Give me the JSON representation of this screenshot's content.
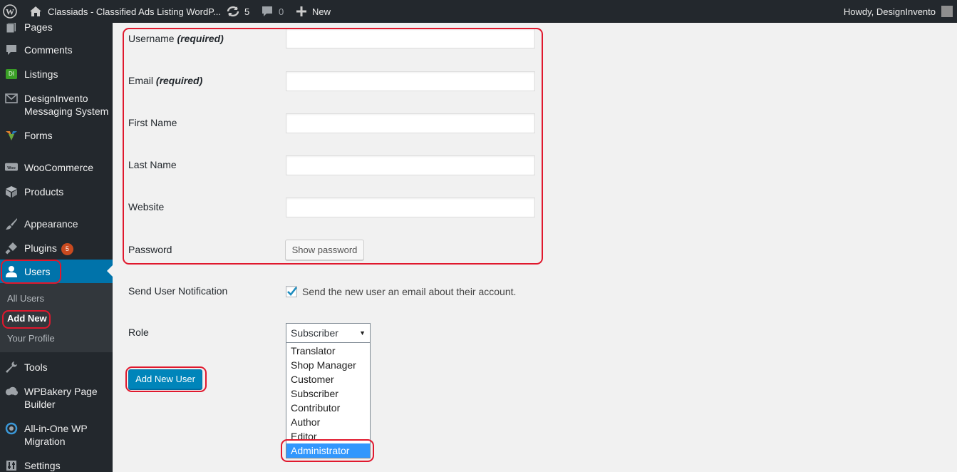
{
  "admin_bar": {
    "site_title": "Classiads - Classified Ads Listing WordP...",
    "updates_count": "5",
    "comments_count": "0",
    "new_label": "New",
    "howdy": "Howdy, DesignInvento"
  },
  "sidebar": {
    "items": [
      {
        "label": "Pages",
        "icon": "pages-icon"
      },
      {
        "label": "Comments",
        "icon": "comment-icon"
      },
      {
        "label": "Listings",
        "icon": "di-icon",
        "icon_text": "DI"
      },
      {
        "label": "DesignInvento Messaging System",
        "label_line1": "DesignInvento",
        "label_line2": "Messaging System",
        "icon": "mail-icon"
      },
      {
        "label": "Forms",
        "icon": "forms-icon"
      },
      {
        "label": "WooCommerce",
        "icon": "woocommerce-icon",
        "icon_text": "Woo"
      },
      {
        "label": "Products",
        "icon": "box-icon"
      },
      {
        "label": "Appearance",
        "icon": "paintbrush-icon"
      },
      {
        "label": "Plugins",
        "icon": "plugin-icon",
        "badge": "5"
      },
      {
        "label": "Users",
        "icon": "user-icon",
        "current": true
      },
      {
        "label": "Tools",
        "icon": "wrench-icon"
      },
      {
        "label": "WPBakery Page Builder",
        "label_line1": "WPBakery Page",
        "label_line2": "Builder",
        "icon": "cloud-icon"
      },
      {
        "label": "All-in-One WP Migration",
        "label_line1": "All-in-One WP",
        "label_line2": "Migration",
        "icon": "migration-icon"
      },
      {
        "label": "Settings",
        "icon": "settings-icon"
      }
    ],
    "users_submenu": [
      {
        "label": "All Users"
      },
      {
        "label": "Add New",
        "current": true
      },
      {
        "label": "Your Profile"
      }
    ]
  },
  "form": {
    "username_label": "Username",
    "required_text": "(required)",
    "email_label": "Email",
    "first_name_label": "First Name",
    "last_name_label": "Last Name",
    "website_label": "Website",
    "password_label": "Password",
    "show_password_button": "Show password",
    "notification_label": "Send User Notification",
    "notification_checkbox_text": "Send the new user an email about their account.",
    "notification_checked": true,
    "role_label": "Role",
    "role_selected": "Subscriber",
    "role_options": [
      "Translator",
      "Shop Manager",
      "Customer",
      "Subscriber",
      "Contributor",
      "Author",
      "Editor",
      "Administrator"
    ],
    "role_highlighted": "Administrator",
    "submit_button": "Add New User",
    "field_values": {
      "username": "",
      "email": "",
      "first_name": "",
      "last_name": "",
      "website": ""
    }
  },
  "colors": {
    "admin_bar_bg": "#23282d",
    "sidebar_bg": "#23282d",
    "submenu_bg": "#32373c",
    "current_menu": "#0073aa",
    "primary_button": "#0085ba",
    "highlight_annotation": "#e0182d",
    "badge": "#ca4a1f",
    "option_selected": "#3297fd"
  }
}
